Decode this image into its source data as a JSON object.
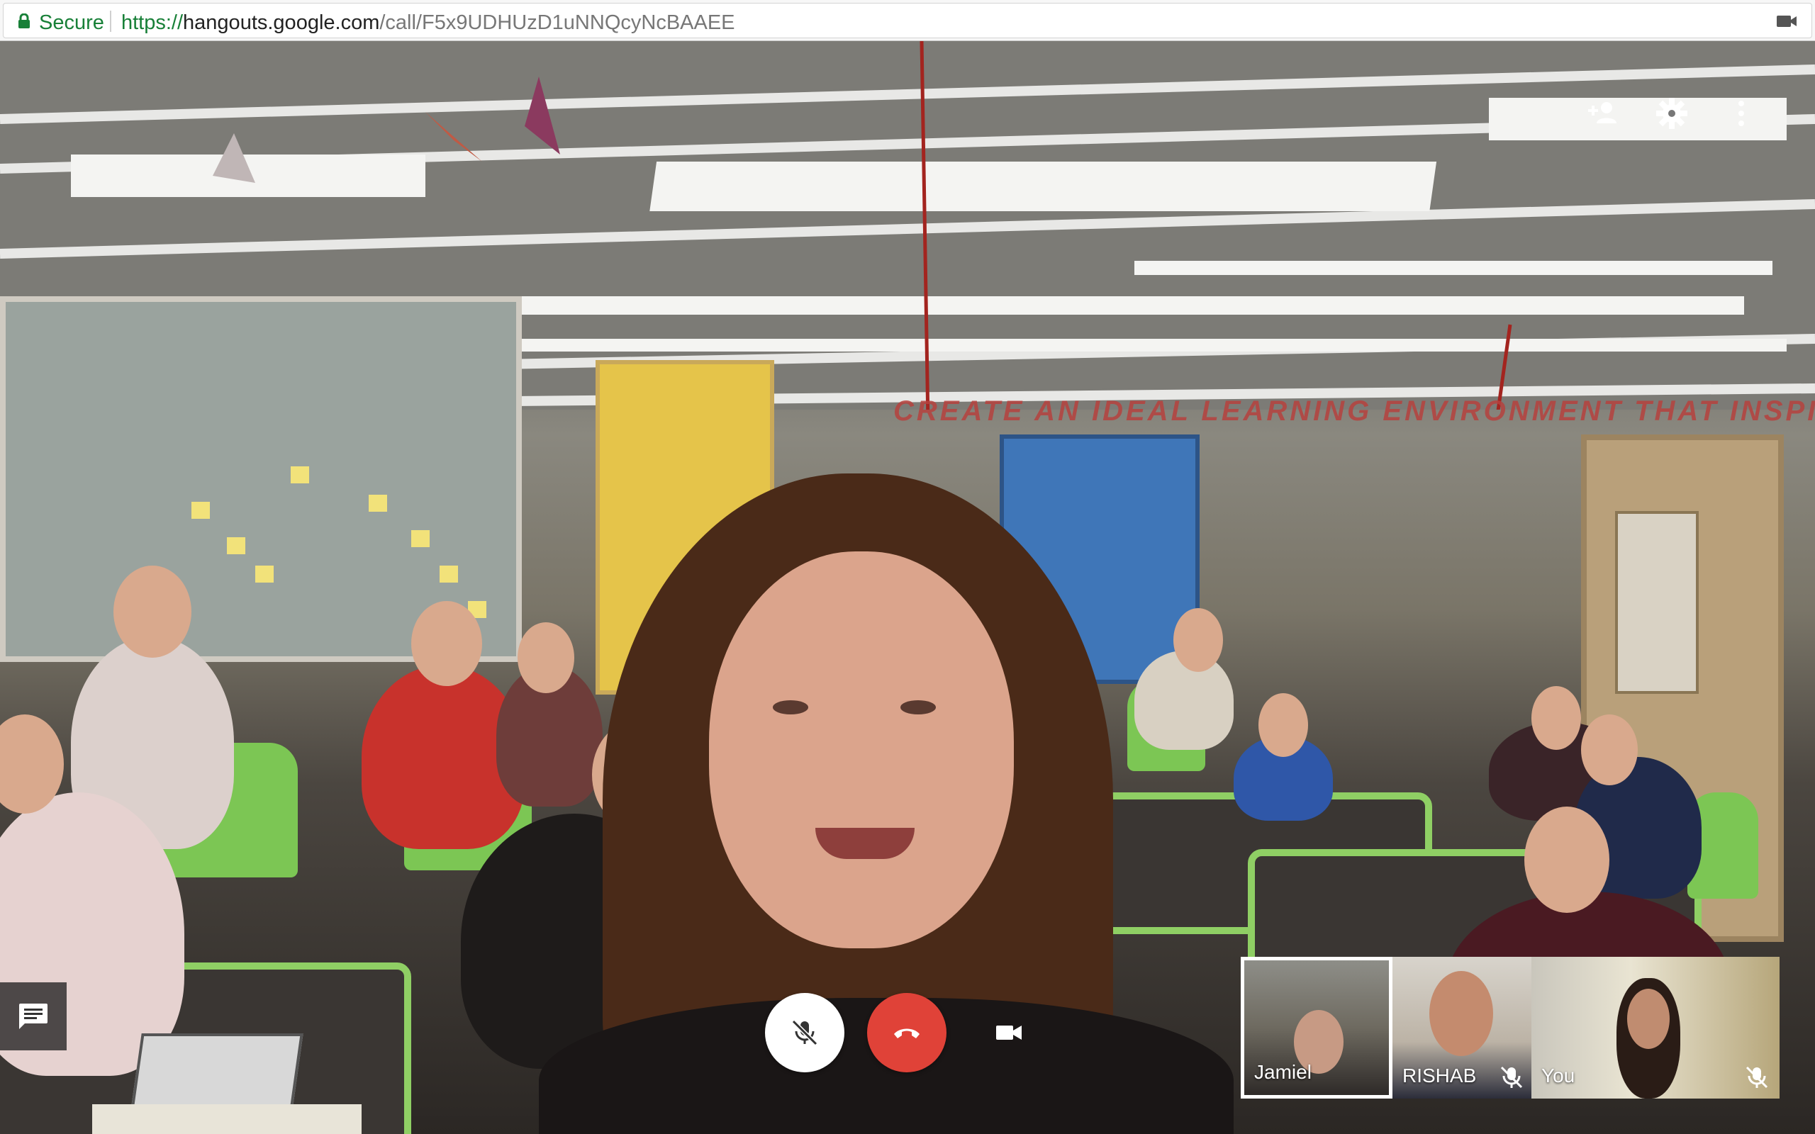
{
  "browser": {
    "secure_label": "Secure",
    "url_scheme": "https://",
    "url_host": "hangouts.google.com",
    "url_path": "/call/F5x9UDHUzD1uNNQcyNcBAAEE",
    "right_icon": "camera-icon"
  },
  "scene": {
    "banner": "CREATE AN IDEAL LEARNING ENVIRONMENT THAT INSPIRE"
  },
  "top_controls": [
    {
      "icon": "add-person-icon"
    },
    {
      "icon": "gear-icon"
    },
    {
      "icon": "more-vert-icon"
    }
  ],
  "chat": {
    "icon": "chat-icon"
  },
  "call_controls": {
    "mic": {
      "icon": "mic-off-icon",
      "state": "muted"
    },
    "hangup": {
      "icon": "hangup-icon",
      "color": "#e04238"
    },
    "video": {
      "icon": "videocam-icon"
    }
  },
  "participants": [
    {
      "name": "Jamiel",
      "selected": true,
      "muted": false
    },
    {
      "name": "RISHAB",
      "selected": false,
      "muted": true
    },
    {
      "name": "You",
      "selected": false,
      "muted": true
    }
  ],
  "colors": {
    "secure_green": "#188038",
    "hangup_red": "#e04238",
    "selected_border": "#ffffff"
  }
}
